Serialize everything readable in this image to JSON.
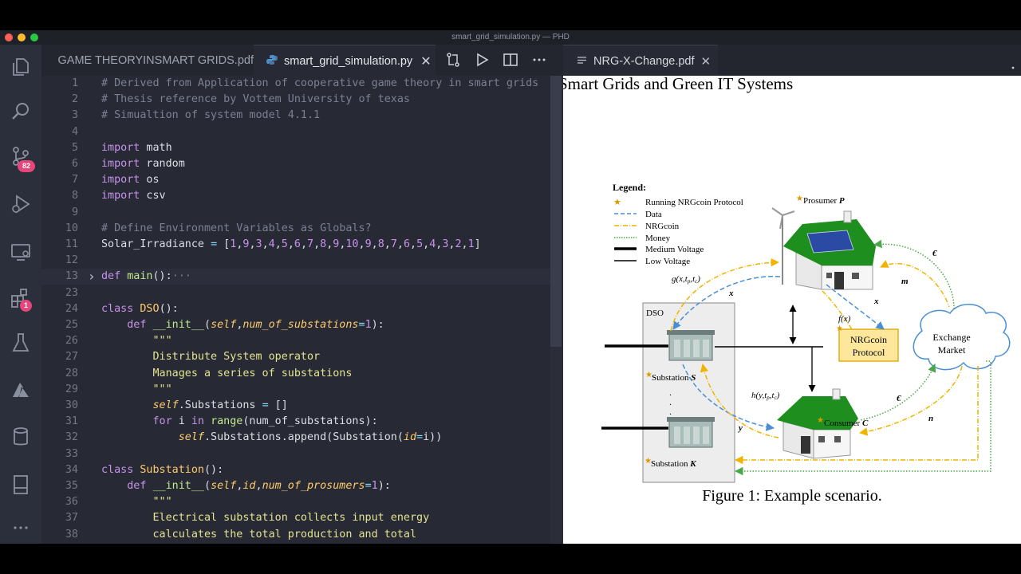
{
  "window": {
    "title": "smart_grid_simulation.py — PHD"
  },
  "activity_bar": {
    "source_control_badge": "82",
    "extensions_badge": "1"
  },
  "editor_tabs": [
    {
      "label": "GAME THEORYINSMART GRIDS.pdf"
    },
    {
      "label": "smart_grid_simulation.py"
    }
  ],
  "pdf_tab": {
    "label": "NRG-X-Change.pdf"
  },
  "code_lines": [
    {
      "n": "1",
      "html": "<span class='cmt'># Derived from Application of cooperative game theory in smart grids</span>"
    },
    {
      "n": "2",
      "html": "<span class='cmt'># Thesis reference by Vottem University of texas</span>"
    },
    {
      "n": "3",
      "html": "<span class='cmt'># Simualtion of system model 4.1.1</span>"
    },
    {
      "n": "4",
      "html": ""
    },
    {
      "n": "5",
      "html": "<span class='kw'>import</span> math"
    },
    {
      "n": "6",
      "html": "<span class='kw'>import</span> random"
    },
    {
      "n": "7",
      "html": "<span class='kw'>import</span> os"
    },
    {
      "n": "8",
      "html": "<span class='kw'>import</span> csv"
    },
    {
      "n": "9",
      "html": ""
    },
    {
      "n": "10",
      "html": "<span class='cmt'># Define Environment Variables as Globals?</span>"
    },
    {
      "n": "11",
      "html": "Solar_Irradiance <span class='op'>=</span> [<span class='num'>1</span>,<span class='num'>9</span>,<span class='num'>3</span>,<span class='num'>4</span>,<span class='num'>5</span>,<span class='num'>6</span>,<span class='num'>7</span>,<span class='num'>8</span>,<span class='num'>9</span>,<span class='num'>10</span>,<span class='num'>9</span>,<span class='num'>8</span>,<span class='num'>7</span>,<span class='num'>6</span>,<span class='num'>5</span>,<span class='num'>4</span>,<span class='num'>3</span>,<span class='num'>2</span>,<span class='num'>1</span>]"
    },
    {
      "n": "12",
      "html": ""
    },
    {
      "n": "13",
      "html": "<span class='kw'>def</span> <span class='fn'>main</span>():<span class='cmt'>···</span>",
      "folded": true
    },
    {
      "n": "23",
      "html": ""
    },
    {
      "n": "24",
      "html": "<span class='kw'>class</span> <span class='cls'>DSO</span>():"
    },
    {
      "n": "25",
      "html": "    <span class='kw'>def</span> <span class='fn'>__init__</span>(<span class='slf'>self</span>,<span class='param'>num_of_substations</span><span class='op'>=</span><span class='num'>1</span>):"
    },
    {
      "n": "26",
      "html": "        <span class='str'>\"\"\"</span>"
    },
    {
      "n": "27",
      "html": "        <span class='str'>Distribute System operator</span>"
    },
    {
      "n": "28",
      "html": "        <span class='str'>Manages a series of substations</span>"
    },
    {
      "n": "29",
      "html": "        <span class='str'>\"\"\"</span>"
    },
    {
      "n": "30",
      "html": "        <span class='slf'>self</span>.Substations <span class='op'>=</span> []"
    },
    {
      "n": "31",
      "html": "        <span class='kw'>for</span> i <span class='kw'>in</span> <span class='fn'>range</span>(num_of_substations):"
    },
    {
      "n": "32",
      "html": "            <span class='slf'>self</span>.Substations.append(Substation(<span class='param'>id</span><span class='op'>=</span>i))"
    },
    {
      "n": "33",
      "html": ""
    },
    {
      "n": "34",
      "html": "<span class='kw'>class</span> <span class='cls'>Substation</span>():"
    },
    {
      "n": "35",
      "html": "    <span class='kw'>def</span> <span class='fn'>__init__</span>(<span class='slf'>self</span>,<span class='param'>id</span>,<span class='param'>num_of_prosumers</span><span class='op'>=</span><span class='num'>1</span>):"
    },
    {
      "n": "36",
      "html": "        <span class='str'>\"\"\"</span>"
    },
    {
      "n": "37",
      "html": "        <span class='str'>Electrical substation collects input energy</span>"
    },
    {
      "n": "38",
      "html": "        <span class='str'>calculates the total production and total</span>"
    }
  ],
  "pdf": {
    "header": "Smart Grids and Green IT Systems",
    "caption": "Figure 1: Example scenario.",
    "legend_title": "Legend:",
    "legend": [
      {
        "label": "Running NRGcoin Protocol",
        "style": "star"
      },
      {
        "label": "Data",
        "style": "dashed-blue"
      },
      {
        "label": "NRGcoin",
        "style": "dashdot-yellow"
      },
      {
        "label": "Money",
        "style": "dotted-green"
      },
      {
        "label": "Medium Voltage",
        "style": "thick-black"
      },
      {
        "label": "Low Voltage",
        "style": "thin-black"
      }
    ],
    "labels": {
      "prosumer": "Prosumer",
      "prosumer_var": "P",
      "consumer": "Consumer",
      "consumer_var": "C",
      "dso": "DSO",
      "substation_s": "Substation",
      "substation_s_var": "S",
      "substation_k": "Substation",
      "substation_k_var": "K",
      "nrgcoin_protocol_1": "NRGcoin",
      "nrgcoin_protocol_2": "Protocol",
      "exchange_1": "Exchange",
      "exchange_2": "Market",
      "g_func": "g(x,t",
      "g_sub1": "p",
      "g_sub2": "c",
      "h_func": "h(y,t",
      "fx": "f(x)",
      "x1": "x",
      "x2": "x",
      "y": "y",
      "m": "m",
      "n": "n",
      "euro1": "€",
      "euro2": "€",
      "dots": "."
    }
  },
  "colors": {
    "data": "#4a8fd6",
    "nrgcoin": "#f0b400",
    "money": "#4aa84a",
    "house_roof": "#1e8f1e",
    "protocol_box": "#fde79a"
  }
}
